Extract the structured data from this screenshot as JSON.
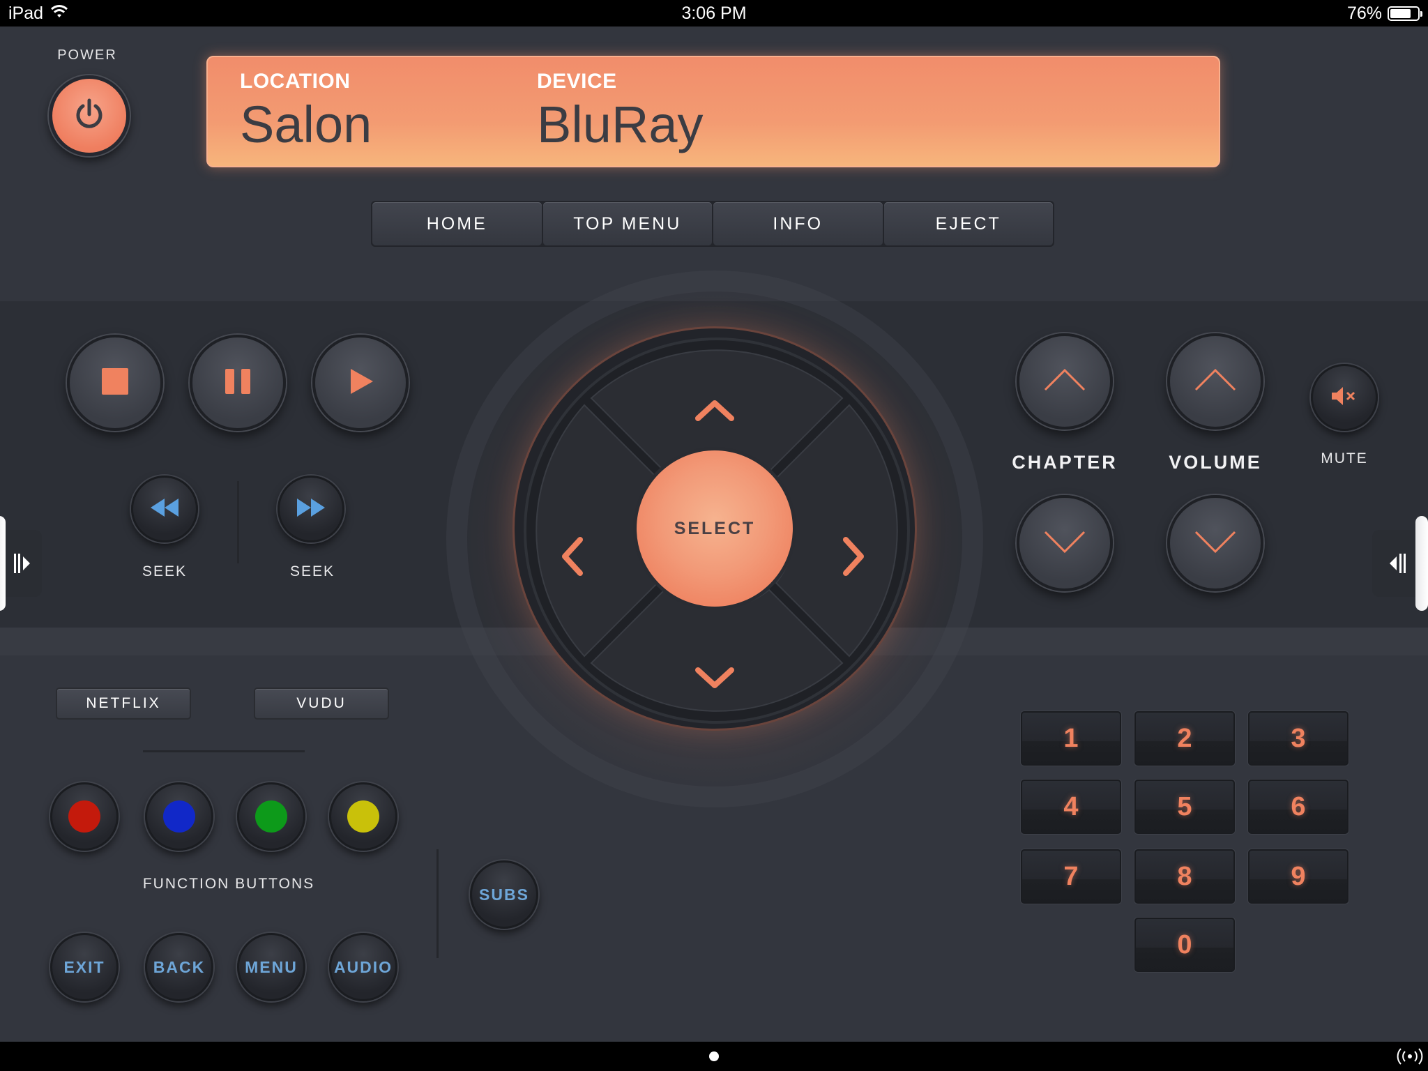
{
  "status_bar": {
    "device": "iPad",
    "time": "3:06 PM",
    "battery": "76%",
    "battery_level": 0.76
  },
  "power": {
    "label": "POWER"
  },
  "display": {
    "location_key": "LOCATION",
    "location_value": "Salon",
    "device_key": "DEVICE",
    "device_value": "BluRay"
  },
  "top_menu": [
    "HOME",
    "TOP MENU",
    "INFO",
    "EJECT"
  ],
  "transport": {
    "seek_back_label": "SEEK",
    "seek_forward_label": "SEEK"
  },
  "dpad": {
    "select_label": "SELECT"
  },
  "controls": {
    "chapter_label": "CHAPTER",
    "volume_label": "VOLUME",
    "mute_label": "MUTE"
  },
  "apps": {
    "netflix": "NETFLIX",
    "vudu": "VUDU"
  },
  "function": {
    "label": "FUNCTION BUTTONS",
    "colors": [
      "#c41a0c",
      "#1128c8",
      "#0d9a1a",
      "#c9c10a"
    ]
  },
  "bottom_buttons": [
    "EXIT",
    "BACK",
    "MENU",
    "AUDIO"
  ],
  "subs": "SUBS",
  "keypad": [
    "1",
    "2",
    "3",
    "4",
    "5",
    "6",
    "7",
    "8",
    "9",
    "0"
  ],
  "colors": {
    "accent": "#f0825f",
    "blue": "#6ea6d8"
  }
}
